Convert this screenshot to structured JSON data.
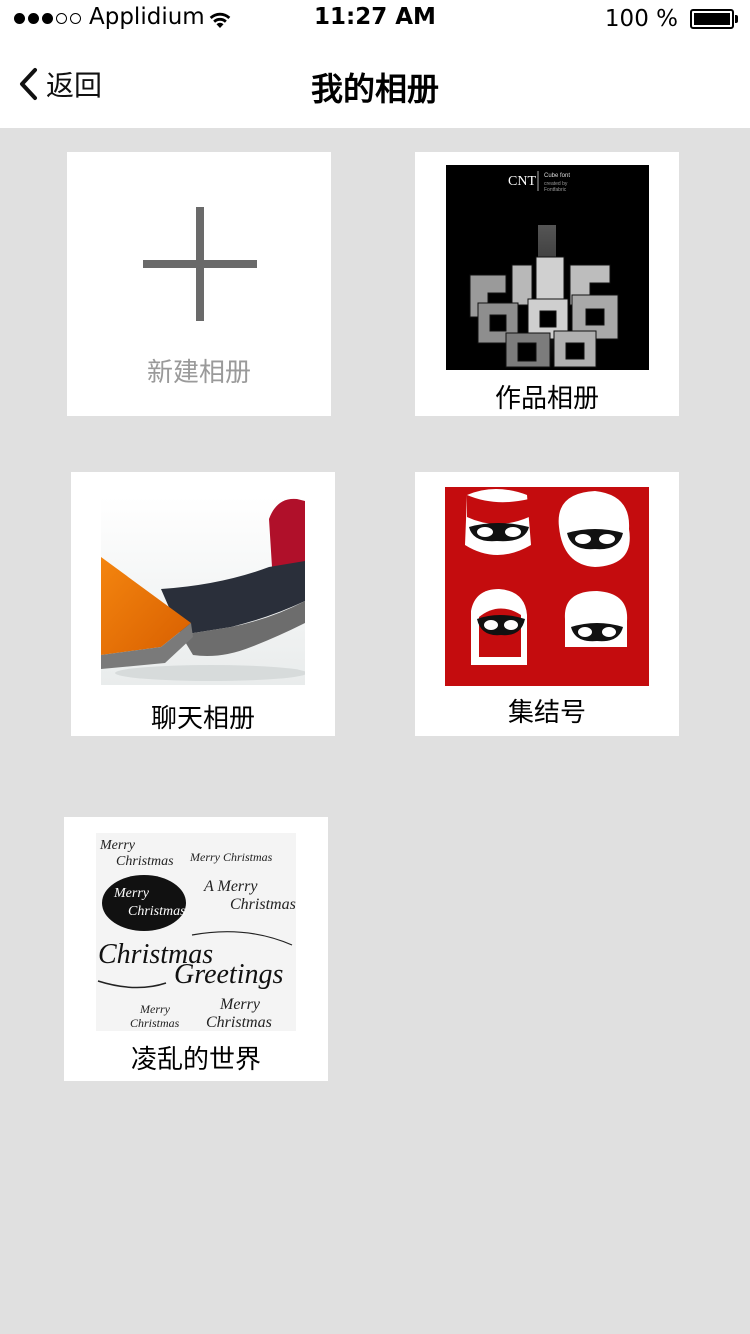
{
  "status_bar": {
    "signal_dots": 5,
    "signal_filled": 3,
    "carrier": "Applidium",
    "time": "11:27 AM",
    "battery_percent": "100 %",
    "battery_level": 1.0
  },
  "nav": {
    "back_label": "返回",
    "title": "我的相册"
  },
  "albums": [
    {
      "label": "新建相册",
      "type": "new",
      "icon": "plus-icon"
    },
    {
      "label": "作品相册",
      "type": "album",
      "thumb": "cube-font-poster",
      "thumb_text": {
        "logo": "CNT",
        "title": "Cube font",
        "credit": "created by\nFontfabric"
      }
    },
    {
      "label": "聊天相册",
      "type": "album",
      "thumb": "modern-sofa-photo"
    },
    {
      "label": "集结号",
      "type": "album",
      "thumb": "masked-heroes-illustration"
    },
    {
      "label": "凌乱的世界",
      "type": "album",
      "thumb": "christmas-lettering",
      "thumb_text": {
        "words": [
          "Merry",
          "Christmas",
          "Merry Christmas",
          "A Merry",
          "Christmas",
          "Merry",
          "Christmas",
          "Christmas",
          "Greetings",
          "Merry",
          "Christmas",
          "Merry",
          "Christmas"
        ]
      }
    }
  ],
  "colors": {
    "background": "#e0e0e0",
    "tile": "#ffffff",
    "plus": "#6a6a6a",
    "new_label": "#9a9a9a"
  }
}
